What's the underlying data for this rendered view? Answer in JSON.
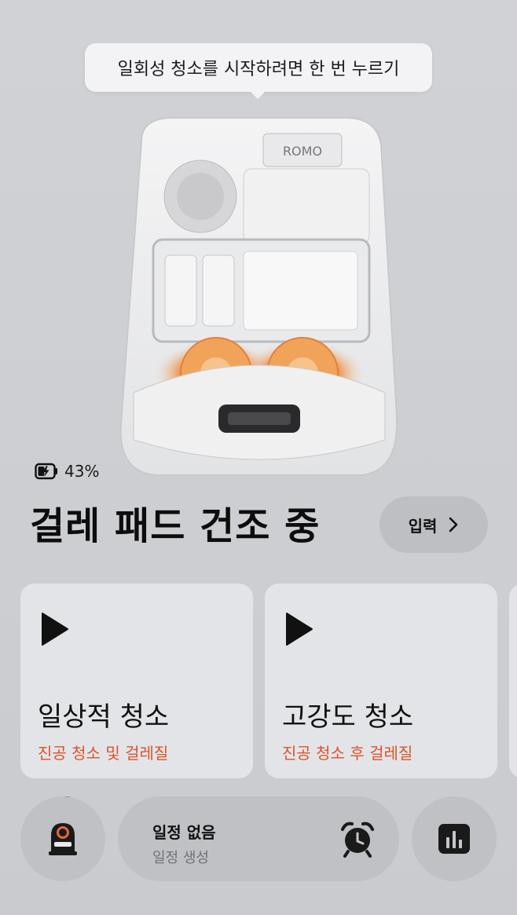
{
  "tooltip": {
    "text": "일회성 청소를 시작하려면 한 번 누르기"
  },
  "robot": {
    "brand": "ROMO"
  },
  "battery": {
    "percent_text": "43%",
    "icon": "battery-charging-icon"
  },
  "status": {
    "title": "걸레 패드 건조 중"
  },
  "enter_button": {
    "label": "입력",
    "icon": "chevron-right-icon"
  },
  "cards": [
    {
      "title": "일상적 청소",
      "subtitle": "진공 청소 및 걸레질",
      "icon": "play-icon"
    },
    {
      "title": "고강도 청소",
      "subtitle": "진공 청소 후 걸레질",
      "icon": "play-icon"
    }
  ],
  "schedule": {
    "title": "일정 없음",
    "subtitle": "일정 생성",
    "icon": "alarm-clock-icon"
  },
  "dock": {
    "left_icon": "robot-station-icon",
    "right_icon": "bar-chart-icon"
  },
  "colors": {
    "accent": "#d9532b",
    "glow": "#f08a3c"
  }
}
